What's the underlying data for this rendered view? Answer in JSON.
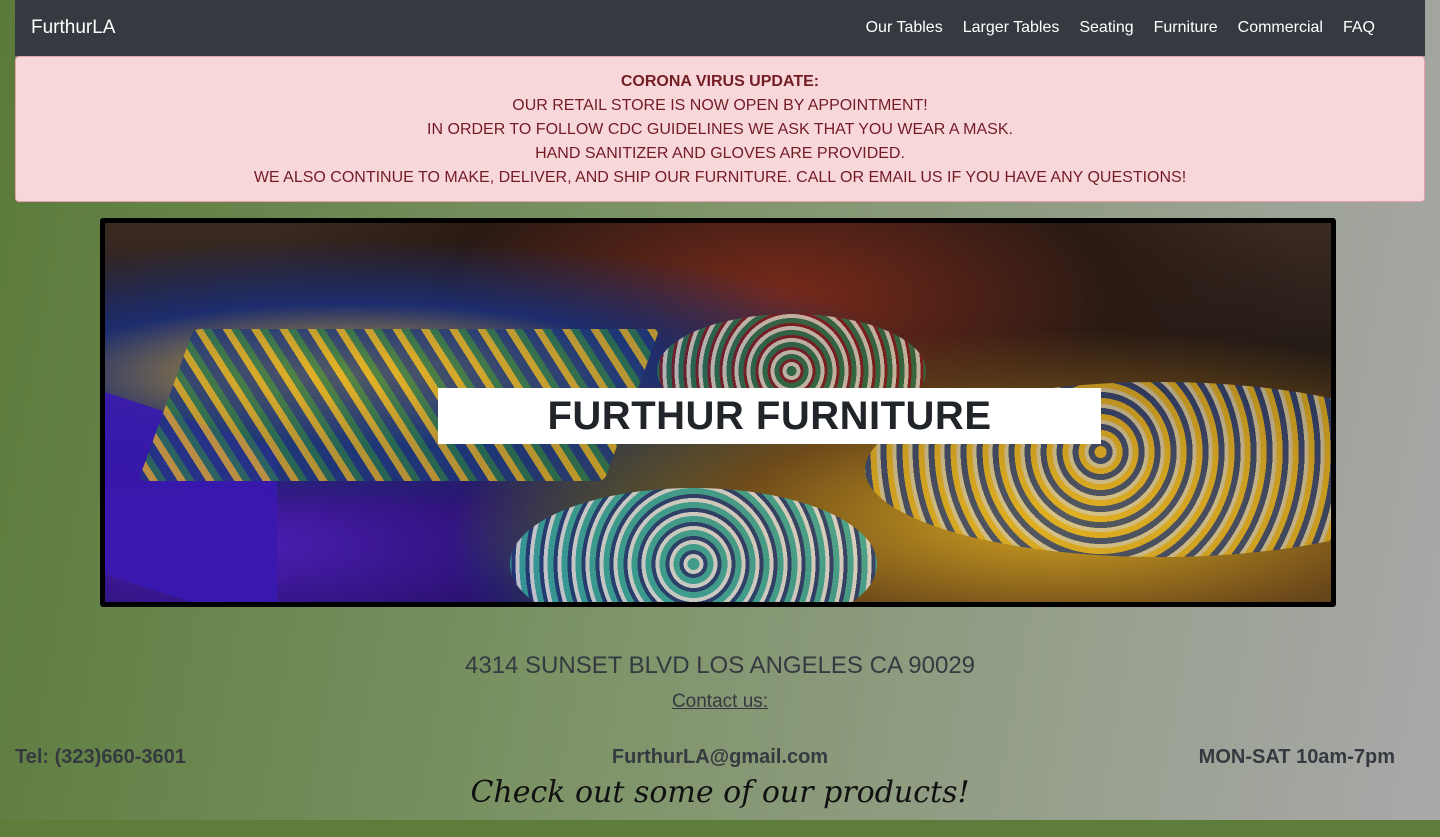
{
  "navbar": {
    "brand": "FurthurLA",
    "links": [
      "Our Tables",
      "Larger Tables",
      "Seating",
      "Furniture",
      "Commercial",
      "FAQ"
    ]
  },
  "alert": {
    "title": "CORONA VIRUS UPDATE:",
    "lines": [
      "OUR RETAIL STORE IS NOW OPEN BY APPOINTMENT!",
      "IN ORDER TO FOLLOW CDC GUIDELINES WE ASK THAT YOU WEAR A MASK.",
      "HAND SANITIZER AND GLOVES ARE PROVIDED.",
      "WE ALSO CONTINUE TO MAKE, DELIVER, AND SHIP OUR FURNITURE. CALL OR EMAIL US IF YOU HAVE ANY QUESTIONS!"
    ]
  },
  "hero": {
    "title": "FURTHUR FURNITURE"
  },
  "contact": {
    "address": "4314 SUNSET BLVD LOS ANGELES CA 90029",
    "contact_link": "Contact us:",
    "tel": "Tel: (323)660-3601",
    "email": "FurthurLA@gmail.com",
    "hours": "MON-SAT 10am-7pm"
  },
  "products_heading": "Check out some of our products!",
  "colors": {
    "navbar_bg": "#343a40",
    "alert_bg": "#f8d7da",
    "alert_text": "#721c24"
  }
}
